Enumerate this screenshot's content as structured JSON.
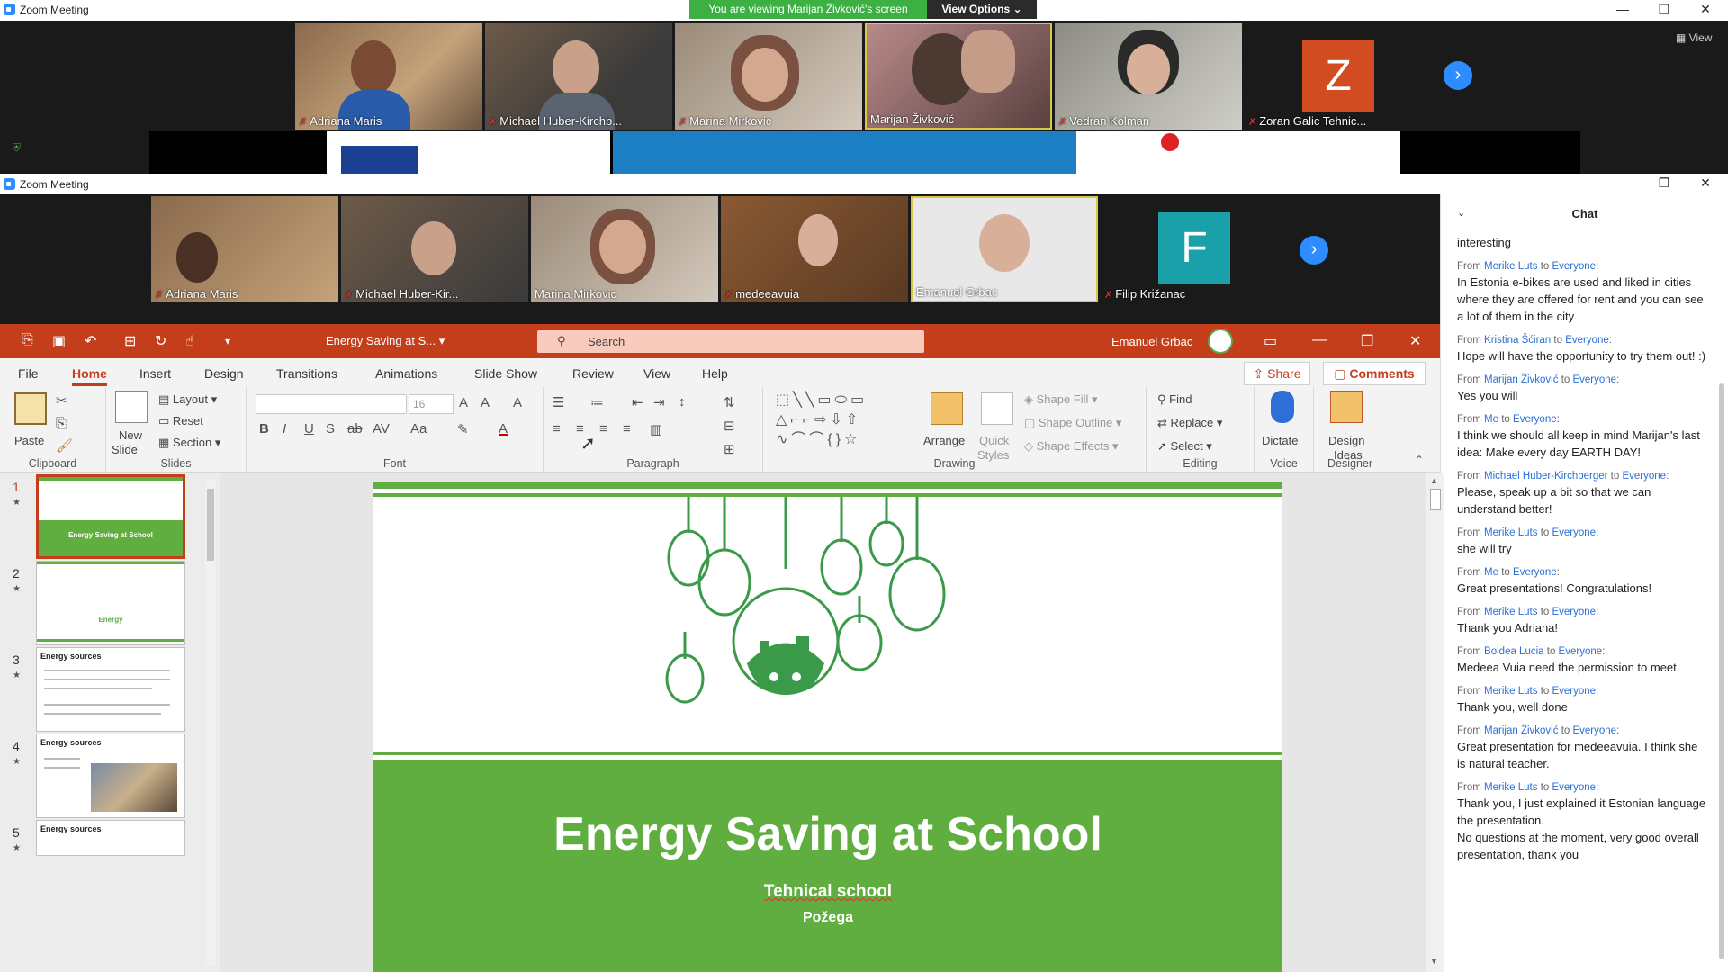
{
  "outer_window": {
    "title": "Zoom Meeting",
    "banner": "You are viewing Marijan Živković's screen",
    "view_options": "View Options",
    "view_label": "View"
  },
  "outer_participants": [
    {
      "name": "Adriana Maris"
    },
    {
      "name": "Michael Huber-Kirchb..."
    },
    {
      "name": "Marina Mirkovic"
    },
    {
      "name": "Marijan Živković"
    },
    {
      "name": "Vedran Kolman"
    },
    {
      "name": "Zoran Galic Tehnic...",
      "avatar_letter": "Z",
      "avatar_color": "#d24c22"
    }
  ],
  "inner_window": {
    "title": "Zoom Meeting"
  },
  "inner_participants": [
    {
      "name": "Adriana Maris"
    },
    {
      "name": "Michael Huber-Kir..."
    },
    {
      "name": "Marina Mirkovic"
    },
    {
      "name": "medeeavuia"
    },
    {
      "name": "Emanuel Grbac"
    },
    {
      "name": "Filip Križanac",
      "avatar_letter": "F",
      "avatar_color": "#1aa0a8"
    }
  ],
  "chat": {
    "title": "Chat",
    "first_line": "interesting",
    "messages": [
      {
        "from": "Merike Luts",
        "to": "Everyone",
        "text": "In Estonia e-bikes are used and liked in cities where they are offered for rent and you can see a lot of them in the city"
      },
      {
        "from": "Kristina Šćiran",
        "to": "Everyone",
        "text": "Hope will have the opportunity to try them out! :)"
      },
      {
        "from": "Marijan Živković",
        "to": "Everyone",
        "text": "Yes you will"
      },
      {
        "from": "Me",
        "to": "Everyone",
        "text": "I think we should all keep in mind Marijan's last idea: Make every day EARTH DAY!"
      },
      {
        "from": "Michael Huber-Kirchberger",
        "to": "Everyone",
        "text": "Please, speak up a bit so that we can understand better!"
      },
      {
        "from": "Merike Luts",
        "to": "Everyone",
        "text": "she will try"
      },
      {
        "from": "Me",
        "to": "Everyone",
        "text": "Great presentations! Congratulations!"
      },
      {
        "from": "Merike Luts",
        "to": "Everyone",
        "text": "Thank you Adriana!"
      },
      {
        "from": "Boldea Lucia",
        "to": "Everyone",
        "text": "Medeea Vuia need the permission to meet"
      },
      {
        "from": "Merike Luts",
        "to": "Everyone",
        "text": "Thank you, well done"
      },
      {
        "from": "Marijan Živković",
        "to": "Everyone",
        "text": "Great presentation for medeeavuia. I think she is natural teacher."
      },
      {
        "from": "Merike Luts",
        "to": "Everyone",
        "text": "Thank you, I just explained it Estonian language the presentation.\nNo questions at the moment, very good overall presentation, thank you"
      }
    ],
    "from_prefix": "From",
    "to_word": "to"
  },
  "ppt": {
    "doc_name": "Energy Saving at S...",
    "search_placeholder": "Search",
    "user_name": "Emanuel Grbac",
    "tabs": [
      "File",
      "Home",
      "Insert",
      "Design",
      "Transitions",
      "Animations",
      "Slide Show",
      "Review",
      "View",
      "Help"
    ],
    "active_tab": "Home",
    "share": "Share",
    "comments": "Comments",
    "ribbon": {
      "clipboard": {
        "label": "Clipboard",
        "paste": "Paste"
      },
      "slides": {
        "label": "Slides",
        "new_slide": "New",
        "new_slide2": "Slide",
        "layout": "Layout",
        "reset": "Reset",
        "section": "Section"
      },
      "font": {
        "label": "Font",
        "size": "16"
      },
      "paragraph": {
        "label": "Paragraph"
      },
      "drawing": {
        "label": "Drawing",
        "arrange": "Arrange",
        "quick_styles1": "Quick",
        "quick_styles2": "Styles",
        "shape_fill": "Shape Fill",
        "shape_outline": "Shape Outline",
        "shape_effects": "Shape Effects"
      },
      "editing": {
        "label": "Editing",
        "find": "Find",
        "replace": "Replace",
        "select": "Select"
      },
      "voice": {
        "label": "Voice",
        "dictate": "Dictate"
      },
      "designer": {
        "label": "Designer",
        "design_ideas1": "Design",
        "design_ideas2": "Ideas"
      }
    },
    "thumbnails": [
      {
        "num": "1",
        "title": "Energy Saving at School"
      },
      {
        "num": "2",
        "title": "Energy"
      },
      {
        "num": "3",
        "title": "Energy sources"
      },
      {
        "num": "4",
        "title": "Energy sources"
      },
      {
        "num": "5",
        "title": "Energy sources"
      }
    ],
    "slide": {
      "title": "Energy Saving at School",
      "subtitle": "Tehnical school",
      "location": "Požega"
    }
  },
  "colors": {
    "ppt_accent": "#c43e1c",
    "slide_green": "#5fae3f",
    "zoom_blue": "#2d8cff",
    "banner_green": "#3cb043"
  }
}
